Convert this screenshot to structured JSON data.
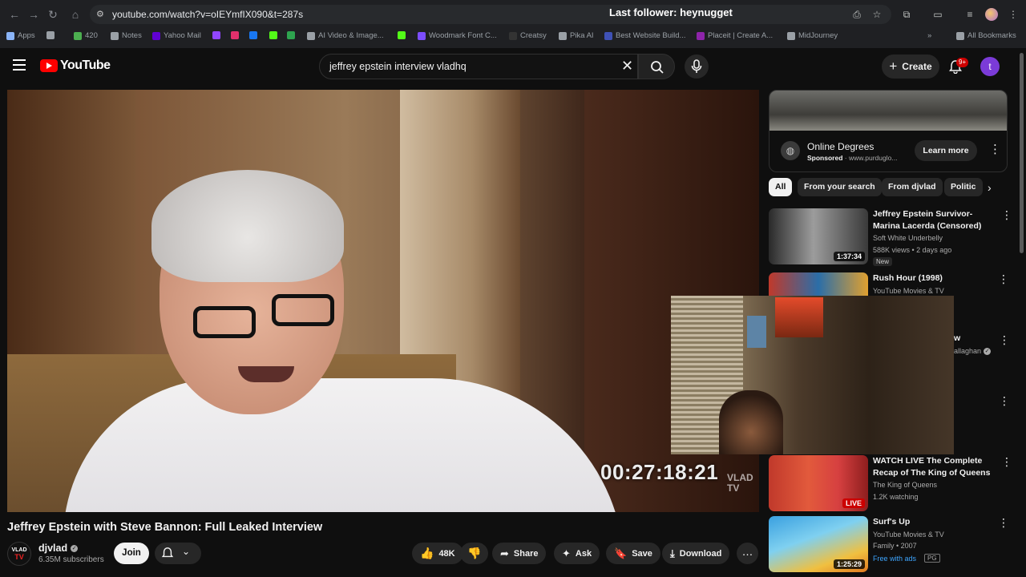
{
  "browser": {
    "url": "youtube.com/watch?v=oIEYmfIX090&t=287s",
    "overlay_title": "Last follower: heynugget",
    "bookmarks": [
      {
        "label": "Apps",
        "color": "#8ab4f8"
      },
      {
        "label": "",
        "color": "#9aa0a6"
      },
      {
        "label": "420",
        "color": "#4caf50"
      },
      {
        "label": "Notes",
        "color": "#9aa0a6"
      },
      {
        "label": "Yahoo Mail",
        "color": "#6001d2"
      },
      {
        "label": "",
        "color": "#9146ff"
      },
      {
        "label": "",
        "color": "#e1306c"
      },
      {
        "label": "",
        "color": "#1877f2"
      },
      {
        "label": "",
        "color": "#53fc18"
      },
      {
        "label": "",
        "color": "#2ea44f"
      },
      {
        "label": "AI Video & Image...",
        "color": "#9aa0a6"
      },
      {
        "label": "",
        "color": "#53fc18"
      },
      {
        "label": "Woodmark Font C...",
        "color": "#7c4dff"
      },
      {
        "label": "Creatsy",
        "color": "#333333"
      },
      {
        "label": "Pika AI",
        "color": "#9aa0a6"
      },
      {
        "label": "Best Website Build...",
        "color": "#3f51b5"
      },
      {
        "label": "Placeit | Create A...",
        "color": "#8e24aa"
      },
      {
        "label": "MidJourney",
        "color": "#9aa0a6"
      },
      {
        "label": "All Bookmarks",
        "color": "#9aa0a6"
      }
    ]
  },
  "header": {
    "logo_text": "YouTube",
    "search_value": "jeffrey epstein interview vladhq",
    "create_label": "Create",
    "notifications_badge": "9+",
    "avatar_letter": "t"
  },
  "player": {
    "timecode": "00:27:18:21",
    "watermark": "VLAD TV"
  },
  "video": {
    "title": "Jeffrey Epstein with Steve Bannon: Full Leaked Interview",
    "channel_name": "djvlad",
    "channel_avatar_top": "VLAD",
    "channel_avatar_bottom": "TV",
    "subscribers": "6.35M subscribers",
    "join_label": "Join",
    "likes": "48K",
    "share_label": "Share",
    "ask_label": "Ask",
    "save_label": "Save",
    "download_label": "Download"
  },
  "ad": {
    "title": "Online Degrees",
    "sponsored": "Sponsored",
    "domain": "www.purduglo...",
    "cta": "Learn more"
  },
  "chips": [
    "All",
    "From your search",
    "From djvlad",
    "Politic"
  ],
  "recommendations": [
    {
      "title": "Jeffrey Epstein Survivor-Marina Lacerda (Censored)",
      "channel": "Soft White Underbelly",
      "meta": "588K views • 2 days ago",
      "badge": "New",
      "duration": "1:37:34"
    },
    {
      "title": "Rush Hour (1998)",
      "channel": "YouTube Movies & TV",
      "meta": "",
      "duration": ""
    },
    {
      "title": "WATCH LIVE The Complete Recap of The King of Queens",
      "channel": "The King of Queens",
      "meta": "1.2K watching",
      "duration": "LIVE"
    },
    {
      "title": "Surf's Up",
      "channel": "YouTube Movies & TV",
      "meta": "Family • 2007",
      "free": "Free with ads",
      "rating": "PG",
      "duration": "1:25:29"
    }
  ],
  "partial_rows": {
    "title_fragment": "w",
    "channel_fragment": "allaghan"
  }
}
